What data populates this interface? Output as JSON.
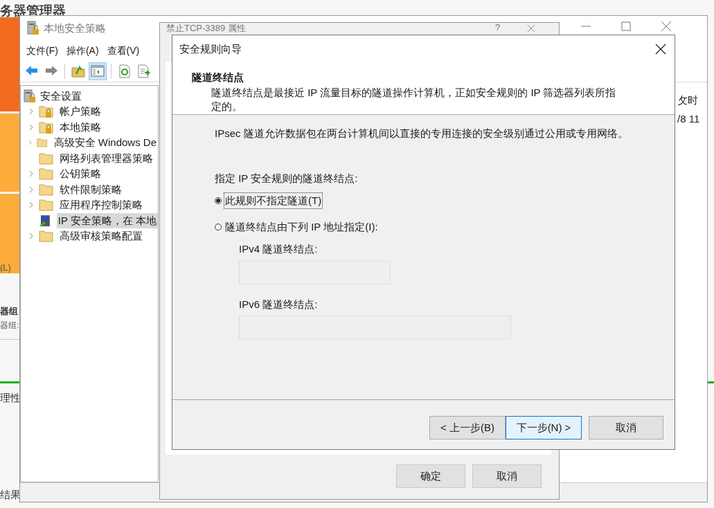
{
  "background_window": {
    "title": "务器管理器",
    "tile_label": "(L)",
    "group_title": "器组",
    "group_label": "器组:",
    "section_label": "理性",
    "footer_label": "结果"
  },
  "policy_window": {
    "title": "本地安全策略",
    "menu": [
      "文件(F)",
      "操作(A)",
      "查看(V)"
    ],
    "toolbar": [
      {
        "kind": "back",
        "selected": false
      },
      {
        "kind": "forward",
        "selected": false
      },
      {
        "kind": "separator"
      },
      {
        "kind": "up",
        "selected": false
      },
      {
        "kind": "tree-toggle",
        "selected": true
      },
      {
        "kind": "separator"
      },
      {
        "kind": "refresh",
        "selected": false
      },
      {
        "kind": "export",
        "selected": false
      }
    ],
    "tree": {
      "label": "安全设置",
      "children": [
        {
          "label": "帐户策略",
          "kind": "locked-folder",
          "expandable": true,
          "selected": false
        },
        {
          "label": "本地策略",
          "kind": "locked-folder",
          "expandable": true,
          "selected": false
        },
        {
          "label": "高级安全 Windows De",
          "kind": "folder",
          "expandable": true,
          "selected": false
        },
        {
          "label": "网络列表管理器策略",
          "kind": "folder",
          "expandable": false,
          "selected": false
        },
        {
          "label": "公钥策略",
          "kind": "folder",
          "expandable": true,
          "selected": false
        },
        {
          "label": "软件限制策略",
          "kind": "folder",
          "expandable": true,
          "selected": false
        },
        {
          "label": "应用程序控制策略",
          "kind": "folder",
          "expandable": true,
          "selected": false
        },
        {
          "label": "IP 安全策略，在 本地",
          "kind": "computer",
          "expandable": false,
          "selected": true
        },
        {
          "label": "高级审核策略配置",
          "kind": "folder",
          "expandable": true,
          "selected": false
        }
      ]
    },
    "list_column": "攵时",
    "list_cell": "/8 11"
  },
  "properties_dialog": {
    "title": "禁止TCP-3389 属性",
    "help": "?",
    "buttons": [
      "确定",
      "取消"
    ]
  },
  "wizard": {
    "title": "安全规则向导",
    "heading": "隧道终结点",
    "description": "隧道终结点是最接近 IP 流量目标的隧道操作计算机，正如安全规则的 IP 筛选器列表所指定的。",
    "intro": "IPsec 隧道允许数据包在两台计算机间以直接的专用连接的安全级别通过公用或专用网络。",
    "prompt": "指定 IP 安全规则的隧道终结点:",
    "options": [
      {
        "label": "此规则不指定隧道(T)",
        "selected": true,
        "focused": true
      },
      {
        "label": "隧道终结点由下列 IP 地址指定(I):",
        "selected": false,
        "focused": false
      }
    ],
    "fields": [
      {
        "label": "IPv4 隧道终结点:",
        "disabled": true,
        "wide": false
      },
      {
        "label": "IPv6 隧道终结点:",
        "disabled": true,
        "wide": true
      }
    ],
    "buttons": [
      {
        "label": "< 上一步(B)",
        "default": false
      },
      {
        "label": "下一步(N) >",
        "default": true
      },
      {
        "label": "取消",
        "default": false
      }
    ]
  }
}
